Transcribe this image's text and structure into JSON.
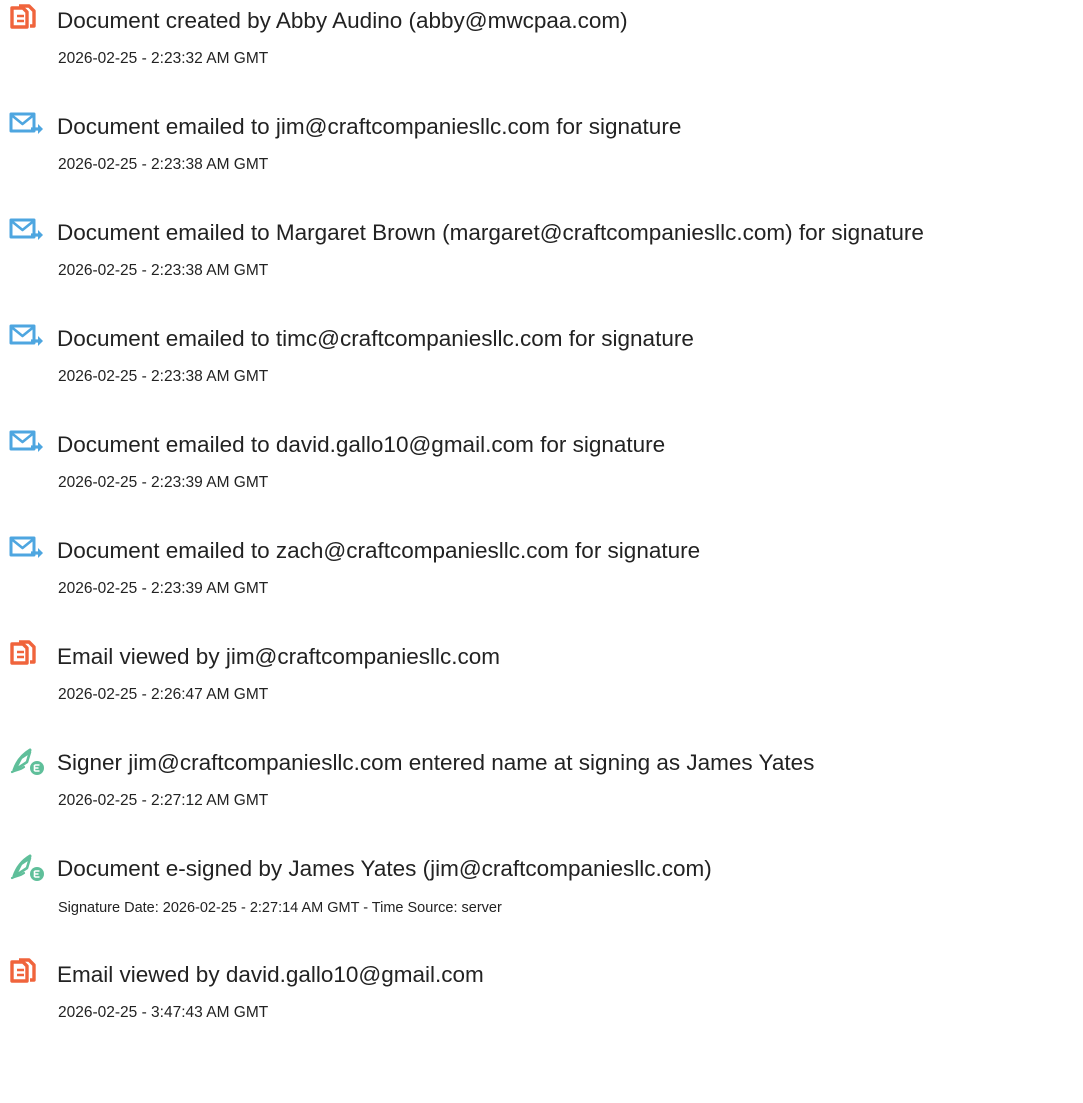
{
  "events": [
    {
      "icon": "document-created-icon",
      "title": "Document created by Abby Audino (abby@mwcpaa.com)",
      "time": "2026-02-25 - 2:23:32 AM GMT"
    },
    {
      "icon": "email-sent-icon",
      "title": "Document emailed to jim@craftcompaniesllc.com for signature",
      "time": "2026-02-25 - 2:23:38 AM GMT"
    },
    {
      "icon": "email-sent-icon",
      "title": "Document emailed to Margaret Brown (margaret@craftcompaniesllc.com) for signature",
      "time": "2026-02-25 - 2:23:38 AM GMT"
    },
    {
      "icon": "email-sent-icon",
      "title": "Document emailed to timc@craftcompaniesllc.com for signature",
      "time": "2026-02-25 - 2:23:38 AM GMT"
    },
    {
      "icon": "email-sent-icon",
      "title": "Document emailed to david.gallo10@gmail.com for signature",
      "time": "2026-02-25 - 2:23:39 AM GMT"
    },
    {
      "icon": "email-sent-icon",
      "title": "Document emailed to zach@craftcompaniesllc.com for signature",
      "time": "2026-02-25 - 2:23:39 AM GMT"
    },
    {
      "icon": "document-viewed-icon",
      "title": "Email viewed by jim@craftcompaniesllc.com",
      "time": "2026-02-25 - 2:26:47 AM GMT"
    },
    {
      "icon": "esign-pen-icon",
      "title": "Signer jim@craftcompaniesllc.com entered name at signing as James Yates",
      "time": "2026-02-25 - 2:27:12 AM GMT"
    },
    {
      "icon": "esign-pen-icon",
      "title": "Document e-signed by James Yates (jim@craftcompaniesllc.com)",
      "time": "Signature Date: 2026-02-25 - 2:27:14 AM GMT - Time Source: server"
    },
    {
      "icon": "document-viewed-icon",
      "title": "Email viewed by david.gallo10@gmail.com",
      "time": "2026-02-25 - 3:47:43 AM GMT"
    }
  ],
  "colors": {
    "document_icon": "#f0643c",
    "email_icon": "#4ea6e0",
    "pen_icon": "#5fbf9a",
    "text": "#222222"
  }
}
